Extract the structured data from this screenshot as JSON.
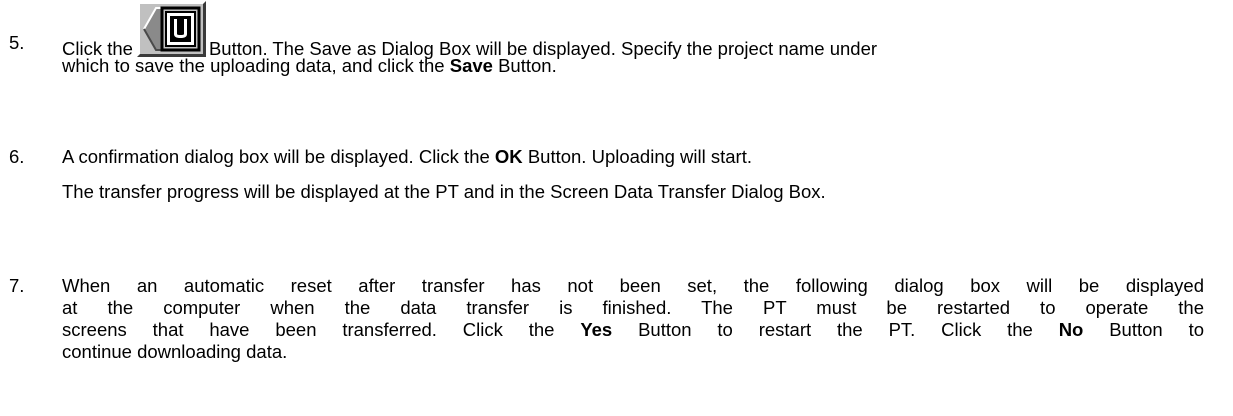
{
  "steps": [
    {
      "number": "5.",
      "line1_before": "Click the",
      "button_icon": "upload-u-button-icon",
      "line1_after": "Button. The Save as Dialog Box will be displayed. Specify the project name under",
      "line2_before": "which to save the uploading data, and click the",
      "line2_bold": "Save",
      "line2_after": "Button."
    },
    {
      "number": "6.",
      "line1_before": "A confirmation dialog box will be displayed. Click the",
      "line1_bold": "OK",
      "line1_after": "Button. Uploading will start.",
      "line2": "The transfer progress will be displayed at the PT and in the Screen Data Transfer Dialog Box."
    },
    {
      "number": "7.",
      "line1": "When an automatic reset after transfer has not been set, the following dialog box will be displayed",
      "line2": "at the computer when the data transfer is finished. The PT must be restarted to operate the",
      "line3_before": "screens that have been transferred. Click the",
      "line3_bold1": "Yes",
      "line3_mid": "Button to restart the PT. Click the",
      "line3_bold2": "No",
      "line3_after": "Button to",
      "line4": "continue downloading data."
    }
  ]
}
